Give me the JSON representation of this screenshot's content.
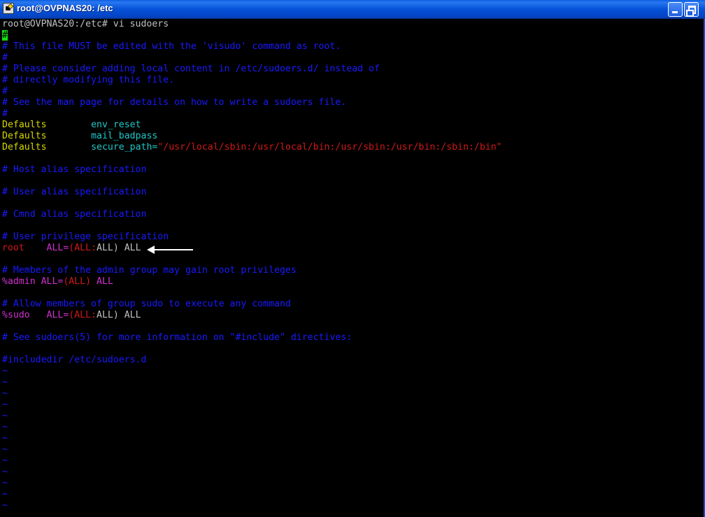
{
  "window": {
    "title": "root@OVPNAS20: /etc"
  },
  "terminal": {
    "prompt_line": "root@OVPNAS20:/etc# vi sudoers",
    "cursor_char": "#",
    "lines": {
      "l1": "# This file MUST be edited with the 'visudo' command as root.",
      "l2": "#",
      "l3": "# Please consider adding local content in /etc/sudoers.d/ instead of",
      "l4": "# directly modifying this file.",
      "l5": "#",
      "l6": "# See the man page for details on how to write a sudoers file.",
      "l7": "#",
      "d1_key": "Defaults",
      "d1_val": "env_reset",
      "d2_key": "Defaults",
      "d2_val": "mail_badpass",
      "d3_key": "Defaults",
      "d3_val": "secure_path=",
      "d3_str": "\"/usr/local/sbin:/usr/local/bin:/usr/sbin:/usr/bin:/sbin:/bin\"",
      "host_alias": "# Host alias specification",
      "user_alias": "# User alias specification",
      "cmnd_alias": "# Cmnd alias specification",
      "user_priv": "# User privilege specification",
      "root_user": "root",
      "root_rule_a": "ALL=",
      "root_rule_b": "(ALL:",
      "root_rule_c": "ALL)",
      "root_rule_d": " ALL",
      "admin_comment": "# Members of the admin group may gain root privileges",
      "admin_user": "%admin",
      "admin_rule_a": "ALL=",
      "admin_rule_b": "(ALL)",
      "admin_rule_c": " ALL",
      "sudo_comment": "# Allow members of group sudo to execute any command",
      "sudo_user": "%sudo",
      "sudo_rule_a": "ALL=",
      "sudo_rule_b": "(ALL:",
      "sudo_rule_c": "ALL)",
      "sudo_rule_d": " ALL",
      "include_comment": "# See sudoers(5) for more information on \"#include\" directives:",
      "includedir": "#includedir /etc/sudoers.d"
    },
    "tilde": "~"
  }
}
